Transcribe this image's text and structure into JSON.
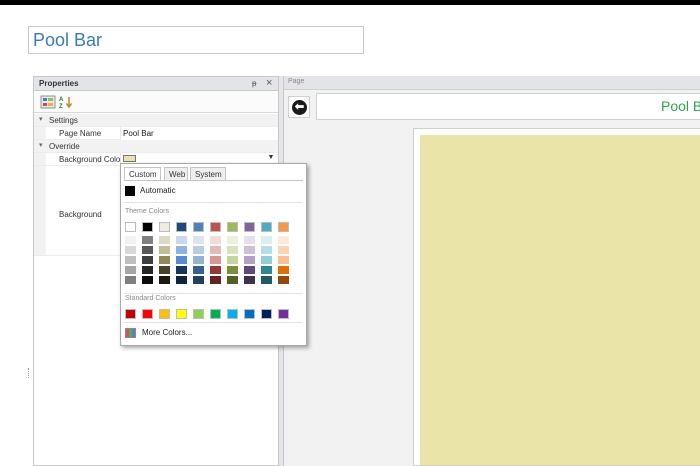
{
  "title_input": {
    "value": "Pool Bar"
  },
  "properties_panel": {
    "title": "Properties",
    "pin": "ᵽ",
    "close": "×",
    "categories": [
      {
        "label": "Settings",
        "rows": [
          {
            "label": "Page Name",
            "value": "Pool Bar"
          }
        ]
      },
      {
        "label": "Override",
        "rows": [
          {
            "label": "Background Color"
          },
          {
            "label": "Background"
          }
        ]
      }
    ],
    "background_color_value": "#ebe4a8"
  },
  "page_panel": {
    "title": "Page",
    "page_title": "Pool Bar",
    "canvas_color": "#ebe4a8"
  },
  "color_popup": {
    "tabs": [
      "Custom",
      "Web",
      "System"
    ],
    "active_tab": "Custom",
    "automatic_label": "Automatic",
    "theme_colors_label": "Theme Colors",
    "standard_colors_label": "Standard Colors",
    "more_colors_label": "More Colors...",
    "theme_top": [
      "#ffffff",
      "#000000",
      "#eeece1",
      "#1f497d",
      "#4f81bd",
      "#c0504d",
      "#9bbb59",
      "#8064a2",
      "#4bacc6",
      "#f79646"
    ],
    "theme_shades": [
      [
        "#f2f2f2",
        "#d8d8d8",
        "#bfbfbf",
        "#a5a5a5",
        "#7f7f7f"
      ],
      [
        "#7f7f7f",
        "#595959",
        "#3f3f3f",
        "#262626",
        "#0c0c0c"
      ],
      [
        "#ddd9c3",
        "#c4bd97",
        "#938953",
        "#494429",
        "#1d1b10"
      ],
      [
        "#c6d9f0",
        "#8db3e2",
        "#548dd4",
        "#17365d",
        "#0f243e"
      ],
      [
        "#dbe5f1",
        "#b8cce4",
        "#95b3d7",
        "#366092",
        "#244061"
      ],
      [
        "#f2dcdb",
        "#e5b9b7",
        "#d99694",
        "#953734",
        "#632423"
      ],
      [
        "#ebf1dd",
        "#d7e3bc",
        "#c3d69b",
        "#76923c",
        "#4f6128"
      ],
      [
        "#e5e0ec",
        "#ccc1d9",
        "#b2a2c7",
        "#5f497a",
        "#3f3151"
      ],
      [
        "#dbeef3",
        "#b7dde8",
        "#92cddc",
        "#31859b",
        "#205867"
      ],
      [
        "#fdeada",
        "#fbd5b5",
        "#fac08f",
        "#e36c09",
        "#974806"
      ]
    ],
    "standard": [
      "#c00000",
      "#ff0000",
      "#ffc000",
      "#ffff00",
      "#92d050",
      "#00b050",
      "#00b0f0",
      "#0070c0",
      "#002060",
      "#7030a0"
    ]
  }
}
